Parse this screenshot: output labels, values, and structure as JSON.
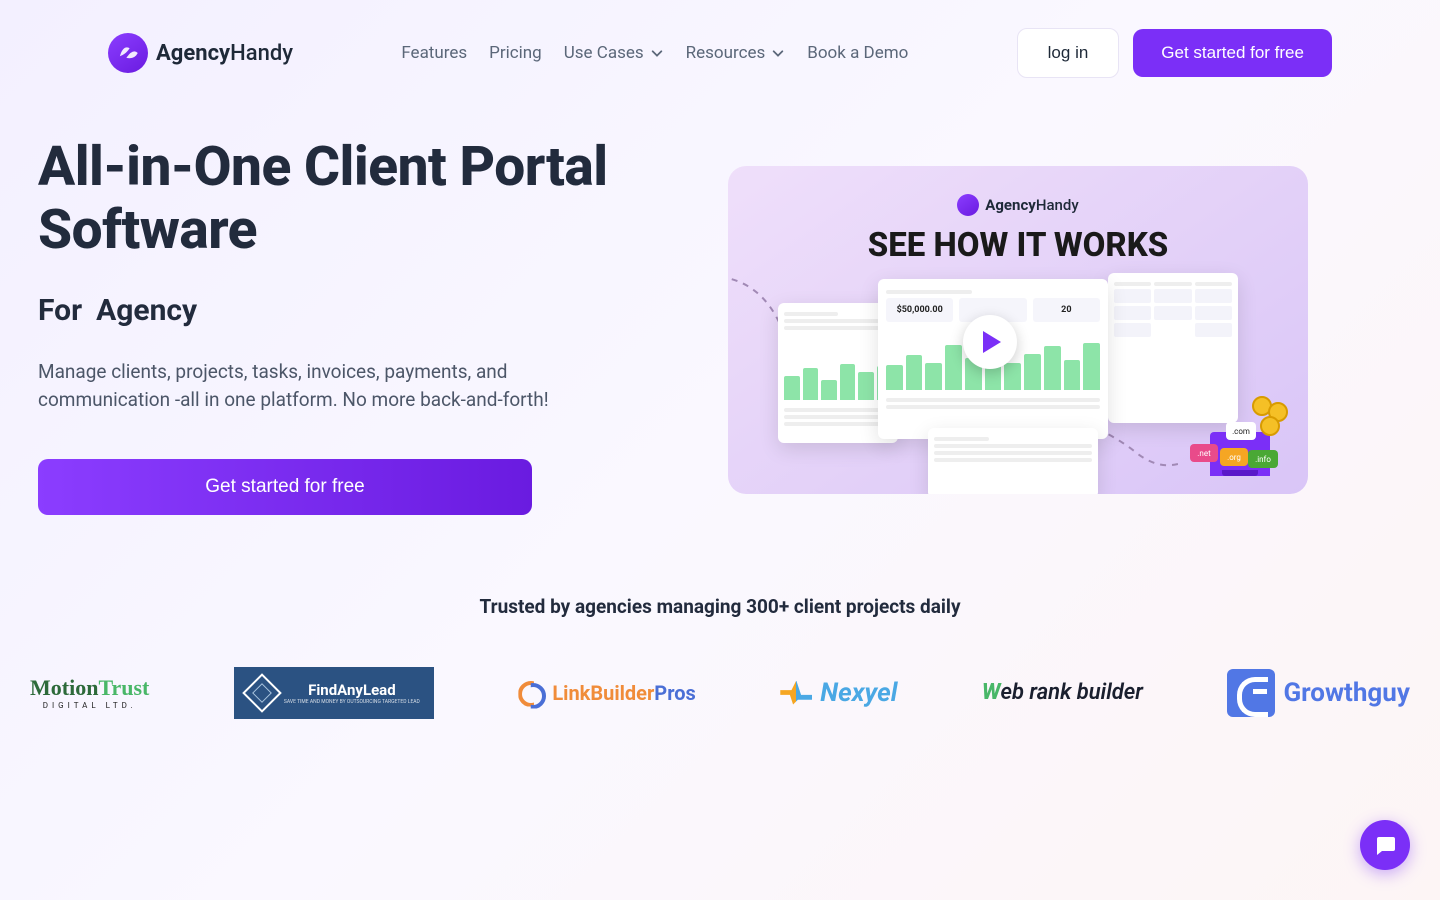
{
  "brand": {
    "name_bold": "Agency",
    "name_light": "Handy"
  },
  "nav": {
    "features": "Features",
    "pricing": "Pricing",
    "use_cases": "Use Cases",
    "resources": "Resources",
    "book_demo": "Book a Demo"
  },
  "header": {
    "login": "log in",
    "cta": "Get started for free"
  },
  "hero": {
    "title": "All-in-One Client Portal Software",
    "for_label": "For",
    "rotating_word": "Agency",
    "description": "Manage clients, projects, tasks, invoices, payments, and communication -all in one platform. No more back-and-forth!",
    "cta": "Get started for free"
  },
  "video": {
    "brand_bold": "Agency",
    "brand_light": "Handy",
    "headline": "SEE HOW IT WORKS",
    "stat_value": "$50,000.00",
    "stat_count": "20"
  },
  "trusted": {
    "title": "Trusted by agencies managing 300+ client projects daily",
    "logos": {
      "motiontrust_main1": "Motion",
      "motiontrust_main2": "Trust",
      "motiontrust_sub": "DIGITAL LTD.",
      "findanylead_main": "FindAnyLead",
      "findanylead_sub": "SAVE TIME AND MONEY BY OUTSOURCING TARGETED LEAD",
      "linkbuilder_1": "LinkBuilder",
      "linkbuilder_2": "Pros",
      "nexyel": "Nexyel",
      "webrank_w": "W",
      "webrank_rest": "eb rank builder",
      "growthguy": "Growthguy"
    }
  }
}
